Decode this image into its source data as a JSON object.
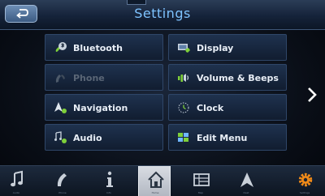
{
  "header": {
    "title": "Settings"
  },
  "menu": {
    "items": [
      {
        "label": "Bluetooth",
        "icon": "bluetooth-icon",
        "enabled": true
      },
      {
        "label": "Display",
        "icon": "display-icon",
        "enabled": true
      },
      {
        "label": "Phone",
        "icon": "phone-icon",
        "enabled": false
      },
      {
        "label": "Volume & Beeps",
        "icon": "volume-icon",
        "enabled": true
      },
      {
        "label": "Navigation",
        "icon": "navigation-icon",
        "enabled": true
      },
      {
        "label": "Clock",
        "icon": "clock-icon",
        "enabled": true
      },
      {
        "label": "Audio",
        "icon": "audio-icon",
        "enabled": true
      },
      {
        "label": "Edit Menu",
        "icon": "edit-menu-icon",
        "enabled": true
      }
    ]
  },
  "pagination": {
    "pages": 2,
    "current": 1
  },
  "bottom_nav": {
    "tabs": [
      {
        "icon": "music-note-icon",
        "label": "Audio",
        "active": false
      },
      {
        "icon": "phone-handset-icon",
        "label": "Phone",
        "active": false
      },
      {
        "icon": "info-icon",
        "label": "Info",
        "active": false
      },
      {
        "icon": "home-icon",
        "label": "Home",
        "active": true
      },
      {
        "icon": "map-icon",
        "label": "Map",
        "active": false
      },
      {
        "icon": "navigation-arrow-icon",
        "label": "Dest",
        "active": false
      },
      {
        "icon": "gear-icon",
        "label": "Settings",
        "active": false
      }
    ]
  },
  "colors": {
    "title": "#7ec3ff",
    "icon_green": "#7ecf3a",
    "icon_blue": "#6fb6ff",
    "settings_orange": "#f08a18",
    "page_dot_active": "#f08a18",
    "page_dot_inactive": "#3d6fa8"
  }
}
